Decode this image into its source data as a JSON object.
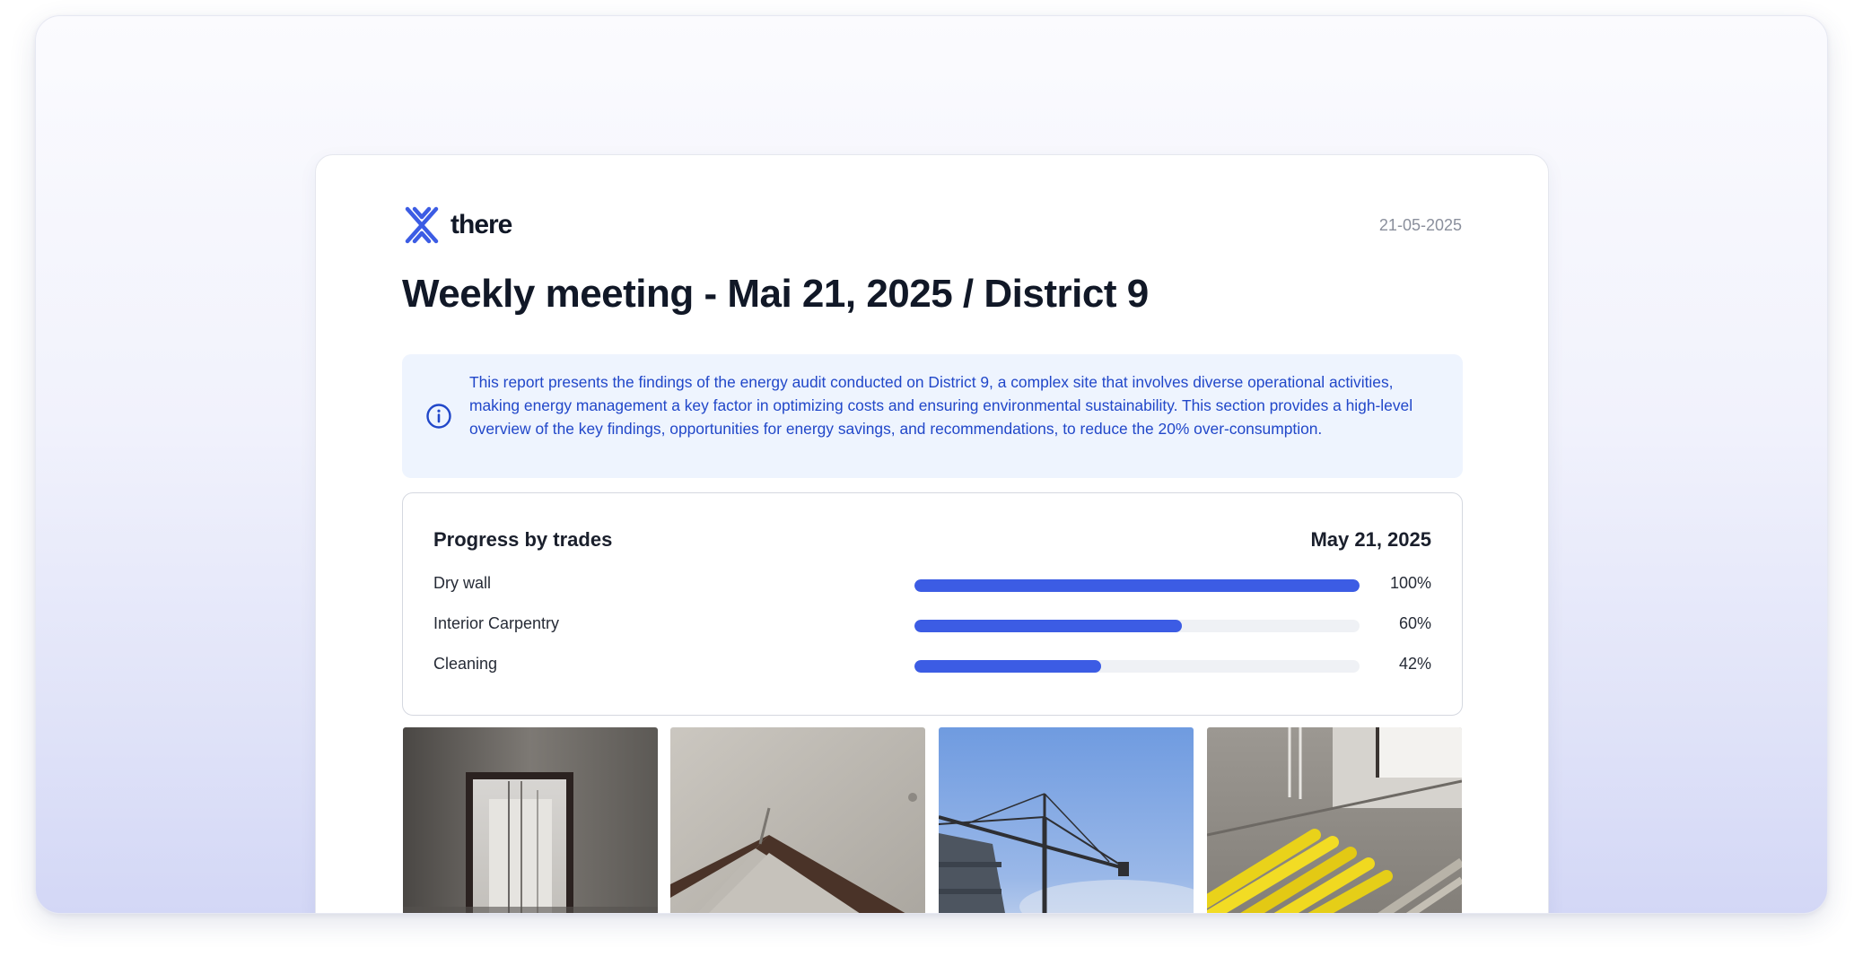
{
  "brand": {
    "name": "there",
    "logo_icon": "there-logo-icon",
    "accent": "#3c5ce4"
  },
  "report": {
    "date": "21-05-2025",
    "title": "Weekly meeting - Mai 21, 2025 / District 9"
  },
  "info_box": {
    "icon": "info-icon",
    "text": "This report presents the findings of the energy audit conducted on District 9, a complex site that involves diverse operational activities, making energy management a key factor in optimizing costs and ensuring environmental sustainability. This section provides a high-level overview of the key findings, opportunities for energy savings, and recommendations, to reduce the 20% over-consumption."
  },
  "progress": {
    "heading": "Progress by trades",
    "date": "May 21, 2025",
    "trades": [
      {
        "label": "Dry wall",
        "percent_label": "100%",
        "value": 1.0
      },
      {
        "label": "Interior Carpentry",
        "percent_label": "60%",
        "value": 0.6
      },
      {
        "label": "Cleaning",
        "percent_label": "42%",
        "value": 0.42
      }
    ]
  },
  "photos": [
    {
      "subject": "interior-doorway-photo"
    },
    {
      "subject": "concrete-ceiling-corner-photo"
    },
    {
      "subject": "tower-crane-photo"
    },
    {
      "subject": "yellow-pipes-on-floor-photo"
    }
  ]
}
